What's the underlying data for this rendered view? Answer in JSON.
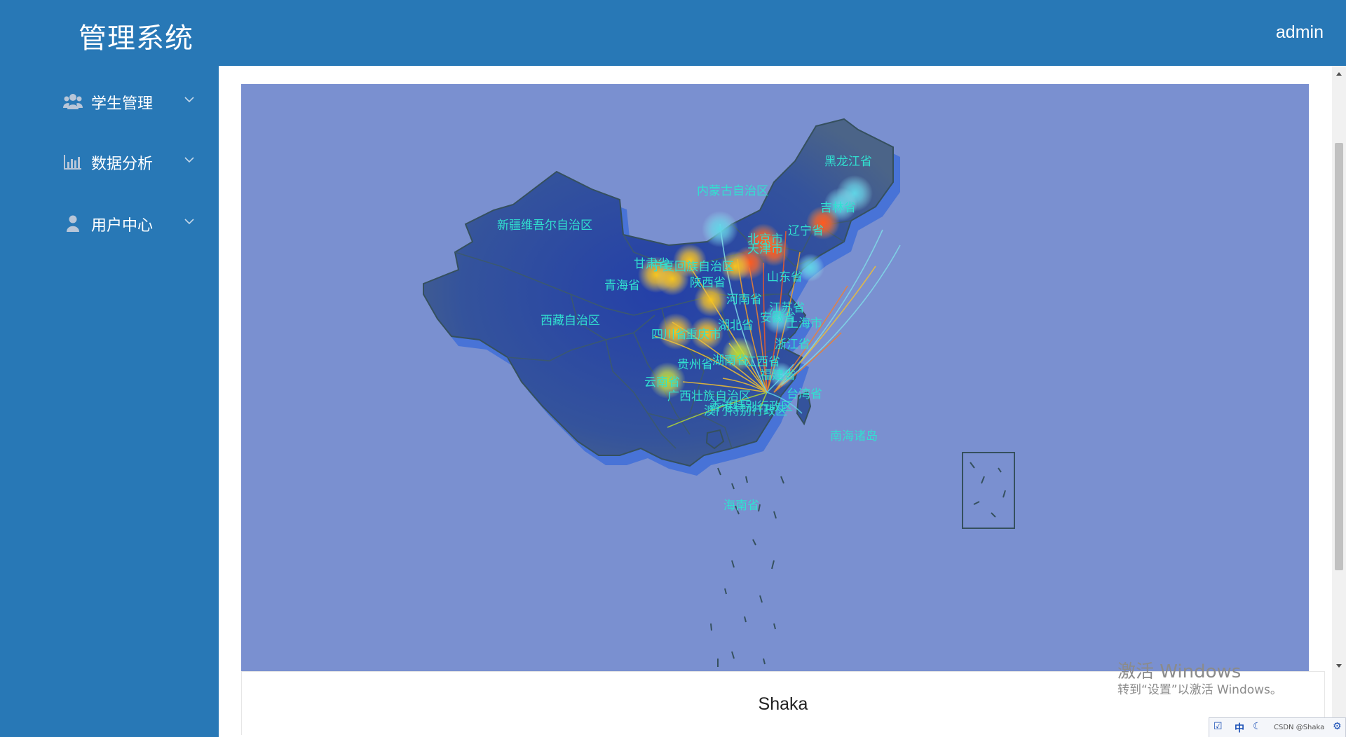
{
  "header": {
    "app_title": "管理系统",
    "user": "admin"
  },
  "sidebar": {
    "items": [
      {
        "label": "学生管理",
        "icon": "users-icon"
      },
      {
        "label": "数据分析",
        "icon": "bar-chart-icon"
      },
      {
        "label": "用户中心",
        "icon": "user-icon"
      }
    ]
  },
  "map": {
    "region_labels": [
      "黑龙江省",
      "吉林省",
      "辽宁省",
      "内蒙古自治区",
      "新疆维吾尔自治区",
      "北京市",
      "天津市",
      "甘肃省",
      "宁夏回族自治区",
      "陕西省",
      "山东省",
      "青海省",
      "河南省",
      "江苏省",
      "安徽省",
      "上海市",
      "湖北省",
      "西藏自治区",
      "四川省",
      "重庆市",
      "浙江省",
      "贵州省",
      "湖南省",
      "江西省",
      "福建省",
      "云南省",
      "广西壮族自治区",
      "台湾省",
      "香港特别行政区",
      "澳门特别行政区",
      "南海诸岛",
      "海南省"
    ],
    "colors": {
      "background": "#7a90d0",
      "land": "#2f4da0",
      "land_edge": "#35505e",
      "label": "#31e0d0",
      "hot_red": "#f05a28",
      "warm_yellow": "#f0c020",
      "cool_cyan": "#5fd5e6",
      "lime": "#b4d832"
    }
  },
  "footer": {
    "text": "Shaka"
  },
  "windows_activation": {
    "title": "激活 Windows",
    "subtitle": "转到“设置”以激活 Windows。"
  },
  "taskbar": {
    "ime": "中",
    "watermark": "CSDN @Shaka"
  }
}
